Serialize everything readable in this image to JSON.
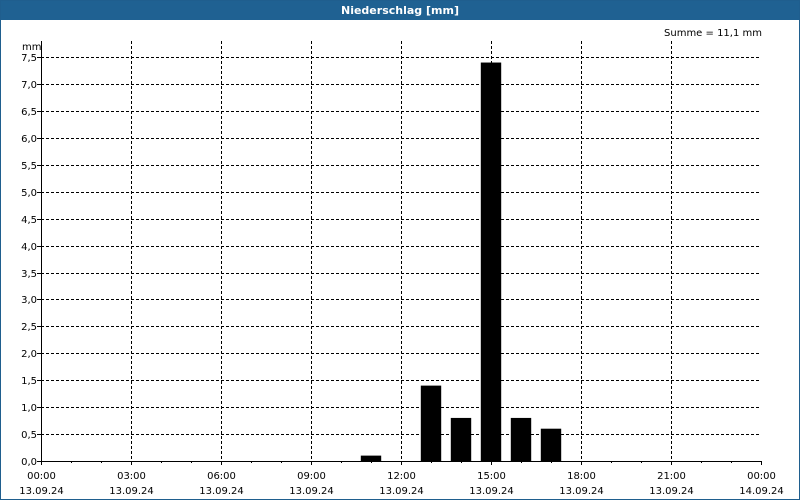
{
  "window": {
    "title": "Niederschlag [mm]"
  },
  "colors": {
    "titlebar": "#1f6192",
    "bar": "#000000",
    "grid": "#000000",
    "background": "#ffffff"
  },
  "chart_data": {
    "type": "bar",
    "title": "Niederschlag [mm]",
    "ylabel": "mm",
    "annotation": "Summe = 11,1 mm",
    "ylim": [
      0,
      7.8
    ],
    "y_ticks": [
      "0,0",
      "0,5",
      "1,0",
      "1,5",
      "2,0",
      "2,5",
      "3,0",
      "3,5",
      "4,0",
      "4,5",
      "5,0",
      "5,5",
      "6,0",
      "6,5",
      "7,0",
      "7,5"
    ],
    "x_ticks": [
      {
        "time": "00:00",
        "date": "13.09.24"
      },
      {
        "time": "03:00",
        "date": "13.09.24"
      },
      {
        "time": "06:00",
        "date": "13.09.24"
      },
      {
        "time": "09:00",
        "date": "13.09.24"
      },
      {
        "time": "12:00",
        "date": "13.09.24"
      },
      {
        "time": "15:00",
        "date": "13.09.24"
      },
      {
        "time": "18:00",
        "date": "13.09.24"
      },
      {
        "time": "21:00",
        "date": "13.09.24"
      },
      {
        "time": "00:00",
        "date": "14.09.24"
      }
    ],
    "x_start": "13.09.24 00:00",
    "x_end": "14.09.24 00:00",
    "bars": [
      {
        "time": "11:00",
        "value": 0.1
      },
      {
        "time": "13:00",
        "value": 1.4
      },
      {
        "time": "14:00",
        "value": 0.8
      },
      {
        "time": "15:00",
        "value": 7.4
      },
      {
        "time": "16:00",
        "value": 0.8
      },
      {
        "time": "17:00",
        "value": 0.6
      }
    ],
    "grid": true
  }
}
